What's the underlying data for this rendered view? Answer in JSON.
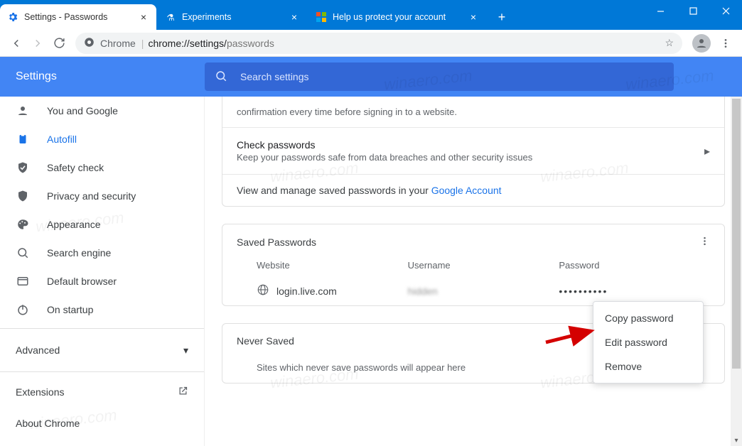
{
  "window": {
    "tabs": [
      {
        "title": "Settings - Passwords",
        "active": true
      },
      {
        "title": "Experiments",
        "active": false
      },
      {
        "title": "Help us protect your account",
        "active": false
      }
    ]
  },
  "toolbar": {
    "url_scheme": "Chrome",
    "url_host": "chrome://settings/",
    "url_path": "passwords"
  },
  "header": {
    "title": "Settings",
    "search_placeholder": "Search settings"
  },
  "sidebar": {
    "items": [
      {
        "label": "You and Google"
      },
      {
        "label": "Autofill"
      },
      {
        "label": "Safety check"
      },
      {
        "label": "Privacy and security"
      },
      {
        "label": "Appearance"
      },
      {
        "label": "Search engine"
      },
      {
        "label": "Default browser"
      },
      {
        "label": "On startup"
      }
    ],
    "advanced": "Advanced",
    "extensions": "Extensions",
    "about": "About Chrome"
  },
  "content": {
    "offer_desc_tail": "confirmation every time before signing in to a website.",
    "check_title": "Check passwords",
    "check_desc": "Keep your passwords safe from data breaches and other security issues",
    "view_manage_pre": "View and manage saved passwords in your ",
    "view_manage_link": "Google Account",
    "saved_title": "Saved Passwords",
    "columns": {
      "website": "Website",
      "username": "Username",
      "password": "Password"
    },
    "row": {
      "site": "login.live.com",
      "user": "hidden",
      "pass": "••••••••••"
    },
    "never_title": "Never Saved",
    "never_empty": "Sites which never save passwords will appear here"
  },
  "menu": {
    "copy": "Copy password",
    "edit": "Edit password",
    "remove": "Remove"
  },
  "watermark": "winaero.com"
}
